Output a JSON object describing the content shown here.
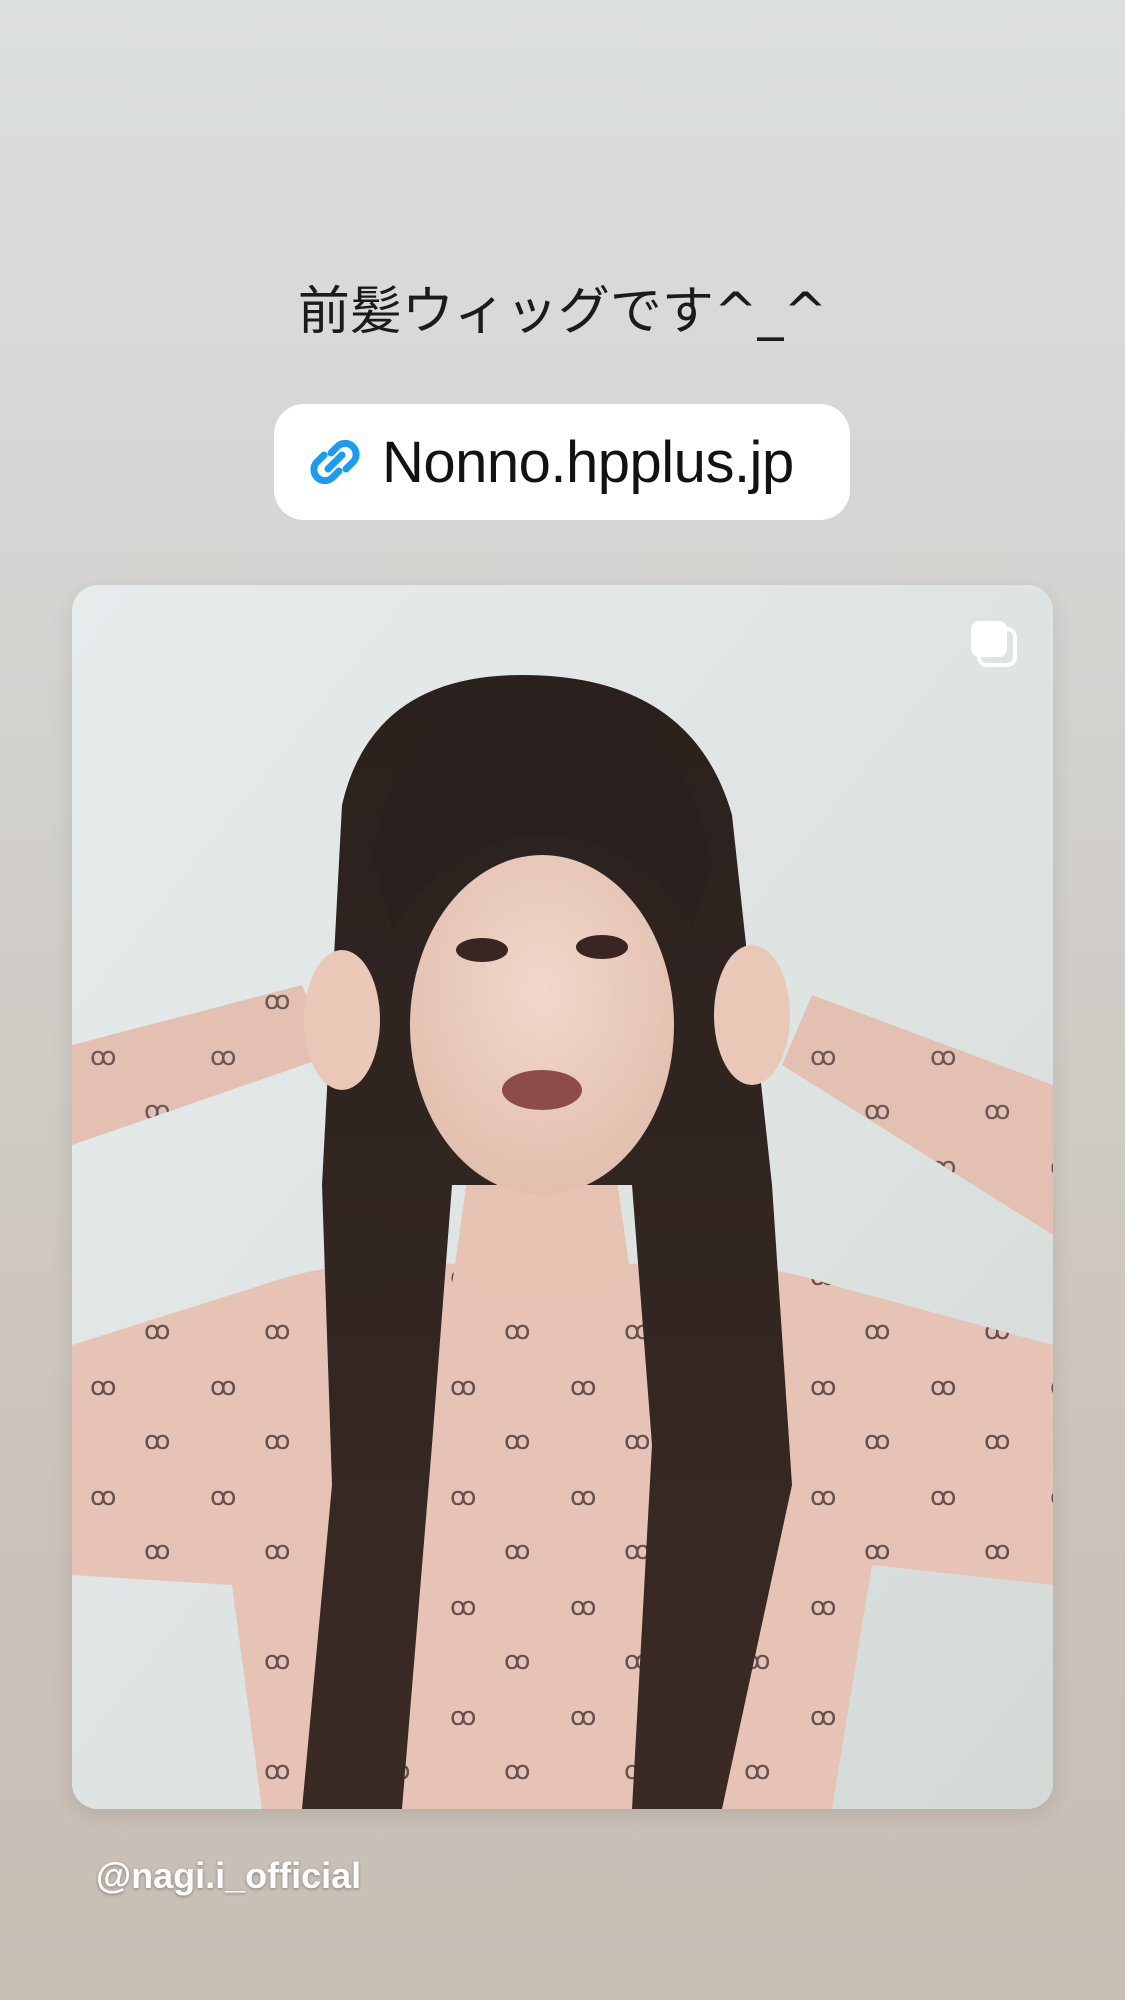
{
  "story": {
    "caption": "前髪ウィッグです^_^",
    "link_sticker": {
      "icon": "link-icon",
      "text": "Nonno.hpplus.jp"
    },
    "post": {
      "badge_icon": "carousel-icon",
      "photo": "photo of a person with long dark hair and bangs, wearing a sheer pink patterned top, hands at temples"
    },
    "username": "@nagi.i_official"
  },
  "colors": {
    "link_icon_blue": "#1d9bf0",
    "sticker_bg": "#ffffff",
    "caption_text": "#1b1b1b"
  }
}
